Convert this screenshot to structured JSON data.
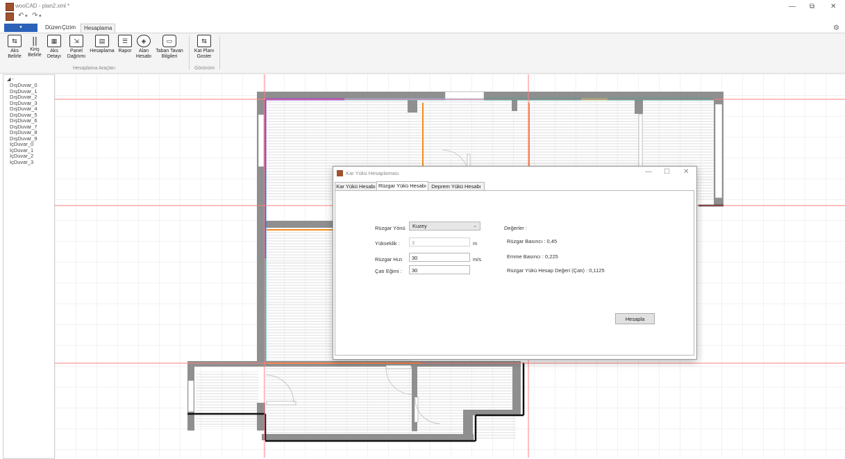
{
  "window": {
    "title": "wooCAD - plan2.xml *",
    "controls": {
      "minimize": "—",
      "restore": "⧉",
      "close": "✕"
    }
  },
  "quick_access": {
    "undo": "↶",
    "redo": "↷",
    "more": "▾"
  },
  "ribbon": {
    "file_tab": "▾",
    "tabs": [
      "Düzen",
      "Çizim",
      "Hesaplama"
    ],
    "active_tab": "Hesaplama",
    "groups": [
      {
        "label": "Hesaplama Araçları",
        "buttons": [
          {
            "icon": "axis-define-icon",
            "label1": "Aks",
            "label2": "Belirle"
          },
          {
            "icon": "beam-define-icon",
            "label1": "Kiriş",
            "label2": "Belirle"
          },
          {
            "icon": "axis-detail-icon",
            "label1": "Aks",
            "label2": "Detayı"
          },
          {
            "icon": "panel-distribution-icon",
            "label1": "Panel",
            "label2": "Dağıtımı"
          },
          {
            "icon": "calculator-icon",
            "label1": "Hesaplama",
            "label2": ""
          },
          {
            "icon": "report-icon",
            "label1": "Rapor",
            "label2": ""
          },
          {
            "icon": "area-calc-icon",
            "label1": "Alan",
            "label2": "Hesabı"
          },
          {
            "icon": "floor-ceiling-icon",
            "label1": "Taban Tavan",
            "label2": "Bilgileri"
          }
        ]
      },
      {
        "label": "Görünüm",
        "buttons": [
          {
            "icon": "floor-plan-icon",
            "label1": "Kat Planı",
            "label2": "Goster"
          }
        ]
      }
    ]
  },
  "tree": {
    "root": "◢ -",
    "items": [
      "DışDuvar_0",
      "DışDuvar_1",
      "DışDuvar_2",
      "DışDuvar_3",
      "DışDuvar_4",
      "DışDuvar_5",
      "DışDuvar_6",
      "DışDuvar_7",
      "DışDuvar_8",
      "DışDuvar_9",
      "İçDuvar_0",
      "İçDuvar_1",
      "İçDuvar_2",
      "İçDuvar_3"
    ]
  },
  "dialog": {
    "title": "Kar Yükü Hesaplaması",
    "controls": {
      "minimize": "—",
      "maximize": "☐",
      "close": "✕"
    },
    "tabs": [
      "Kar Yükü Hesabı",
      "Rüzgar Yükü Hesabı",
      "Deprem Yükü Hesabı"
    ],
    "active_tab": "Rüzgar Yükü Hesabı",
    "form": {
      "direction_label": "Rüzgar Yönü",
      "direction_value": "Kuzey",
      "height_label": "Yükseklik :",
      "height_value": "3",
      "height_unit": "m",
      "speed_label": "Rüzgar Hızı",
      "speed_value": "30",
      "speed_unit": "m/s",
      "slope_label": "Çatı Eğimi :",
      "slope_value": "30"
    },
    "results": {
      "header": "Değerler :",
      "wind_pressure": "Rüzgar Basıncı : 0,45",
      "suction_pressure": "Emme Basıncı : 0,225",
      "wind_load_design": "Rüzgar Yükü Hesap Değeri (Çatı) : 0,1125"
    },
    "calculate_button": "Hesapla"
  },
  "colors": {
    "accent": "#2b62b8",
    "axis_line": "#ff7f7f",
    "wall": "#8f8f8f",
    "wall_purple": "#8a3fd6",
    "wall_blue": "#3b6fd6",
    "wall_cyan": "#20c1cc",
    "wall_lightblue": "#7ab6dd",
    "wall_teal": "#2aa198",
    "wall_green": "#7fbf7f",
    "wall_orange": "#f28c1c"
  }
}
